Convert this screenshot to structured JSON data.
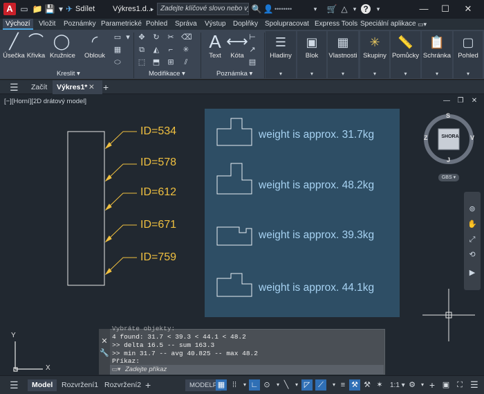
{
  "titlebar": {
    "logo_letter": "A",
    "share_label": "Sdílet",
    "document_title": "Výkres1.d...",
    "search_placeholder": "Zadejte klíčové slovo nebo výraz.",
    "user_label": "••••••••"
  },
  "ribbon_tabs": [
    "Výchozí",
    "Vložit",
    "Poznámky",
    "Parametrické",
    "Pohled",
    "Správa",
    "Výstup",
    "Doplňky",
    "Spolupracovat",
    "Express Tools",
    "Speciální aplikace"
  ],
  "ribbon": {
    "draw_tools": [
      "Úsečka",
      "Křivka",
      "Kružnice",
      "Oblouk"
    ],
    "draw_panel_label": "Kreslit",
    "modify_panel_label": "Modifikace",
    "annotation_tools": [
      "Text",
      "Kóta"
    ],
    "annotation_panel_label": "Poznámka",
    "panels": [
      "Hladiny",
      "Blok",
      "Vlastnosti",
      "Skupiny",
      "Pomůcky",
      "Schránka",
      "Pohled"
    ]
  },
  "doc_tabs": [
    "Začít",
    "Výkres1*"
  ],
  "viewport": {
    "label": "[−][Horní][2D drátový model]",
    "ids": [
      "ID=534",
      "ID=578",
      "ID=612",
      "ID=671",
      "ID=759"
    ],
    "weights": [
      "weight is approx. 31.7kg",
      "weight is approx. 48.2kg",
      "weight is approx. 39.3kg",
      "weight is approx. 44.1kg"
    ],
    "viewcube": {
      "top": "SHORA",
      "north": "S",
      "south": "J",
      "east": "V",
      "west": "Z",
      "wcs": "GBS"
    },
    "ucs_y": "Y",
    "ucs_x": "X"
  },
  "commandline": {
    "lines": [
      "Vybráte objekty:",
      "4 found: 31.7 < 39.3 < 44.1 < 48.2",
      ">> delta 16.5 -- sum 163.3",
      ">> min 31.7 -- avg 40.825 -- max 48.2",
      "Příkaz:"
    ],
    "input_placeholder": "Zadejte příkaz"
  },
  "statusbar": {
    "tabs": [
      "Model",
      "Rozvržení1",
      "Rozvržení2"
    ],
    "modelp": "MODELP",
    "scale": "1:1"
  },
  "colors": {
    "id_text": "#f0c040",
    "weight_text": "#a6d2f2",
    "highlight_panel": "#2f5068",
    "background": "#212830"
  }
}
